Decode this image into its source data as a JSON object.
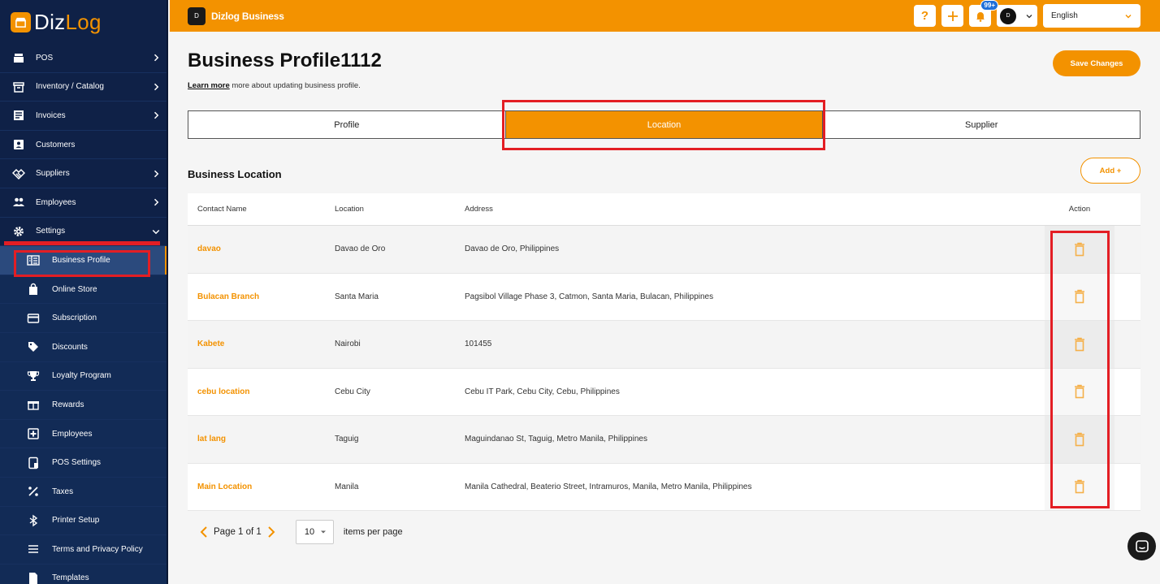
{
  "app": {
    "logo_part1": "Diz",
    "logo_part2": "Log",
    "brand_name": "Dizlog Business",
    "brand_short": "D"
  },
  "sidebar": {
    "items": [
      {
        "label": "POS",
        "icon": "register-icon",
        "chevron": true
      },
      {
        "label": "Inventory / Catalog",
        "icon": "box-icon",
        "chevron": true
      },
      {
        "label": "Invoices",
        "icon": "invoice-icon",
        "chevron": true
      },
      {
        "label": "Customers",
        "icon": "contact-icon",
        "chevron": false
      },
      {
        "label": "Suppliers",
        "icon": "handshake-icon",
        "chevron": true
      },
      {
        "label": "Employees",
        "icon": "people-icon",
        "chevron": true
      },
      {
        "label": "Settings",
        "icon": "gear-icon",
        "chevron": "down"
      }
    ],
    "sub_items": [
      {
        "label": "Business Profile",
        "icon": "building-icon"
      },
      {
        "label": "Online Store",
        "icon": "bag-icon"
      },
      {
        "label": "Subscription",
        "icon": "card-icon"
      },
      {
        "label": "Discounts",
        "icon": "tag-icon"
      },
      {
        "label": "Loyalty Program",
        "icon": "trophy-icon"
      },
      {
        "label": "Rewards",
        "icon": "gift-icon"
      },
      {
        "label": "Employees",
        "icon": "employee-badge-icon"
      },
      {
        "label": "POS Settings",
        "icon": "tablet-icon"
      },
      {
        "label": "Taxes",
        "icon": "percent-icon"
      },
      {
        "label": "Printer Setup",
        "icon": "bluetooth-icon"
      },
      {
        "label": "Terms and Privacy Policy",
        "icon": "lines-icon"
      },
      {
        "label": "Templates",
        "icon": "file-icon"
      }
    ],
    "active_sub": "Business Profile"
  },
  "topbar": {
    "help_icon": "question-icon",
    "add_icon": "plus-icon",
    "notif_badge": "99+",
    "language": "English"
  },
  "page": {
    "title": "Business Profile1112",
    "learn_more": "Learn more",
    "subtitle_rest": " more about updating business profile.",
    "save_label": "Save Changes",
    "tabs": [
      "Profile",
      "Location",
      "Supplier"
    ],
    "active_tab": "Location",
    "section_title": "Business Location",
    "add_label": "Add +"
  },
  "table": {
    "headers": [
      "Contact Name",
      "Location",
      "Address",
      "Action"
    ],
    "rows": [
      {
        "name": "davao",
        "location": "Davao de Oro",
        "address": "Davao de Oro, Philippines"
      },
      {
        "name": "Bulacan Branch",
        "location": "Santa Maria",
        "address": "Pagsibol Village Phase 3, Catmon, Santa Maria, Bulacan, Philippines"
      },
      {
        "name": "Kabete",
        "location": "Nairobi",
        "address": "101455"
      },
      {
        "name": "cebu location",
        "location": "Cebu City",
        "address": "Cebu IT Park, Cebu City, Cebu, Philippines"
      },
      {
        "name": "lat lang",
        "location": "Taguig",
        "address": "Maguindanao St, Taguig, Metro Manila, Philippines"
      },
      {
        "name": "Main Location",
        "location": "Manila",
        "address": "Manila Cathedral, Beaterio Street, Intramuros, Manila, Metro Manila, Philippines"
      }
    ]
  },
  "pagination": {
    "page_label": "Page 1 of 1",
    "per_page": "10",
    "per_page_label": "items per page"
  },
  "colors": {
    "accent": "#f39200",
    "sidebar": "#0f2147",
    "highlight": "#e31e24"
  }
}
